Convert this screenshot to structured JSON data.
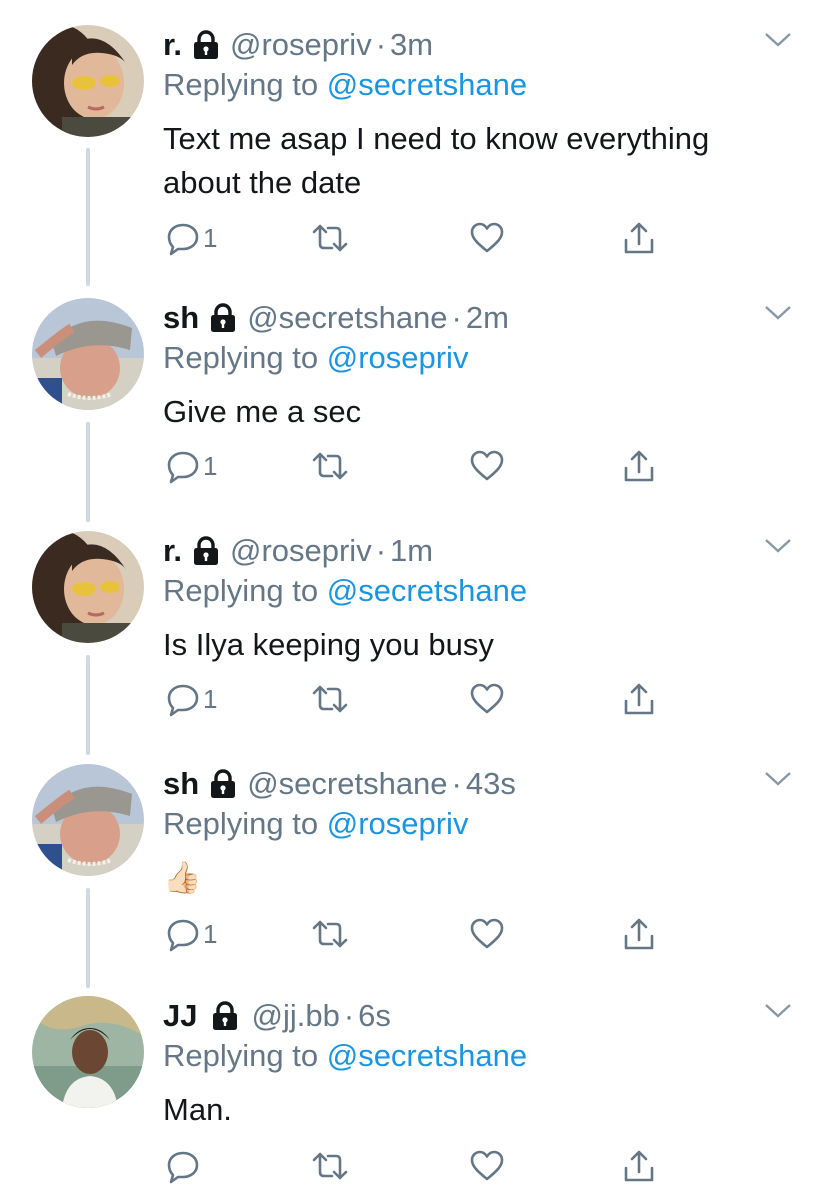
{
  "tweets": [
    {
      "name": "r.",
      "handle": "@rosepriv",
      "time": "3m",
      "reply_prefix": "Replying to",
      "reply_to": "@secretshane",
      "text": "Text me asap I need to know everything about the date",
      "reply_count": "1",
      "avatar": "rose"
    },
    {
      "name": "sh",
      "handle": "@secretshane",
      "time": "2m",
      "reply_prefix": "Replying to",
      "reply_to": "@rosepriv",
      "text": "Give me a sec",
      "reply_count": "1",
      "avatar": "shane"
    },
    {
      "name": "r.",
      "handle": "@rosepriv",
      "time": "1m",
      "reply_prefix": "Replying to",
      "reply_to": "@secretshane",
      "text": "Is Ilya keeping you busy",
      "reply_count": "1",
      "avatar": "rose"
    },
    {
      "name": "sh",
      "handle": "@secretshane",
      "time": "43s",
      "reply_prefix": "Replying to",
      "reply_to": "@rosepriv",
      "text": "👍🏻",
      "reply_count": "1",
      "avatar": "shane"
    },
    {
      "name": "JJ",
      "handle": "@jj.bb",
      "time": "6s",
      "reply_prefix": "Replying to",
      "reply_to": "@secretshane",
      "text": "Man.",
      "reply_count": "",
      "avatar": "jj"
    }
  ],
  "separator": "·",
  "icons": {
    "protected": "lock-icon",
    "more": "chevron-down-icon",
    "reply": "reply-icon",
    "retweet": "retweet-icon",
    "like": "heart-icon",
    "share": "share-icon"
  },
  "colors": {
    "name": "#14171a",
    "secondary": "#657786",
    "mention": "#1b95e0",
    "thread_line": "#cfd9de"
  }
}
